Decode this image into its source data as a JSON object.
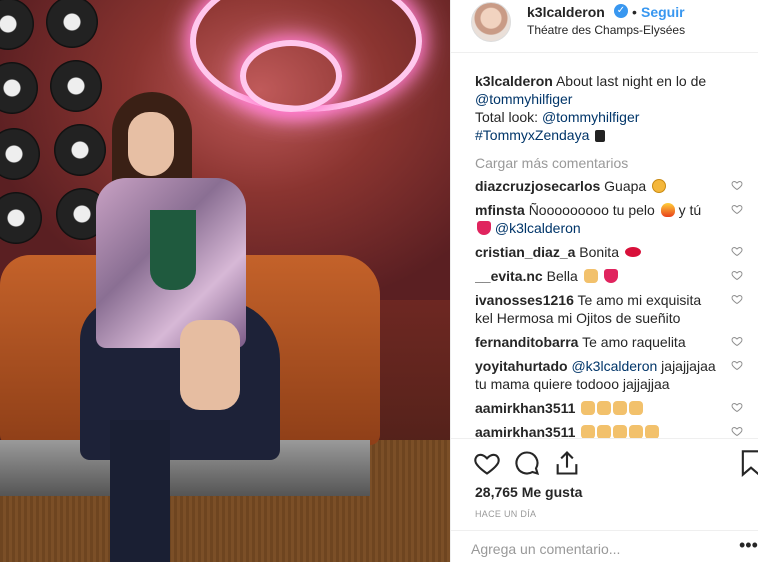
{
  "post": {
    "username": "k3lcalderon",
    "separator": "•",
    "follow_label": "Seguir",
    "location": "Théatre des Champs-Elysées"
  },
  "caption": {
    "username": "k3lcalderon",
    "text1": "About last night en lo de",
    "mention1": "@tommyhilfiger",
    "text2": "Total look:",
    "mention2": "@tommyhilfiger",
    "hashtag": "#TommyxZendaya"
  },
  "load_more": "Cargar más comentarios",
  "comments": [
    {
      "user": "diazcruzjosecarlos",
      "text": "Guapa",
      "emoji": "face"
    },
    {
      "user": "mfinsta",
      "text": "Ñooooooooo tu pelo",
      "text_b": "y tú",
      "mention": "@k3lcalderon"
    },
    {
      "user": "cristian_diaz_a",
      "text": "Bonita"
    },
    {
      "user": "__evita.nc",
      "text": "Bella"
    },
    {
      "user": "ivanosses1216",
      "text": "Te amo mi exquisita kel Hermosa mi Ojitos de sueñito"
    },
    {
      "user": "fernanditobarra",
      "text": "Te amo raquelita"
    },
    {
      "user": "yoyitahurtado",
      "mention": "@k3lcalderon",
      "text": "jajajjajaa tu mama quiere todooo jajjajjaa"
    },
    {
      "user": "aamirkhan3511",
      "text": ""
    },
    {
      "user": "aamirkhan3511",
      "text": ""
    }
  ],
  "likes": "28,765 Me gusta",
  "time_ago": "HACE UN DÍA",
  "add_comment_placeholder": "Agrega un comentario...",
  "more_label": "•••",
  "icons": {
    "verified": "verified-badge-icon",
    "like": "heart-icon",
    "comment": "comment-icon",
    "share": "share-icon",
    "save": "bookmark-icon"
  },
  "colors": {
    "accent": "#3897f0",
    "link": "#003569",
    "muted": "#999999"
  }
}
